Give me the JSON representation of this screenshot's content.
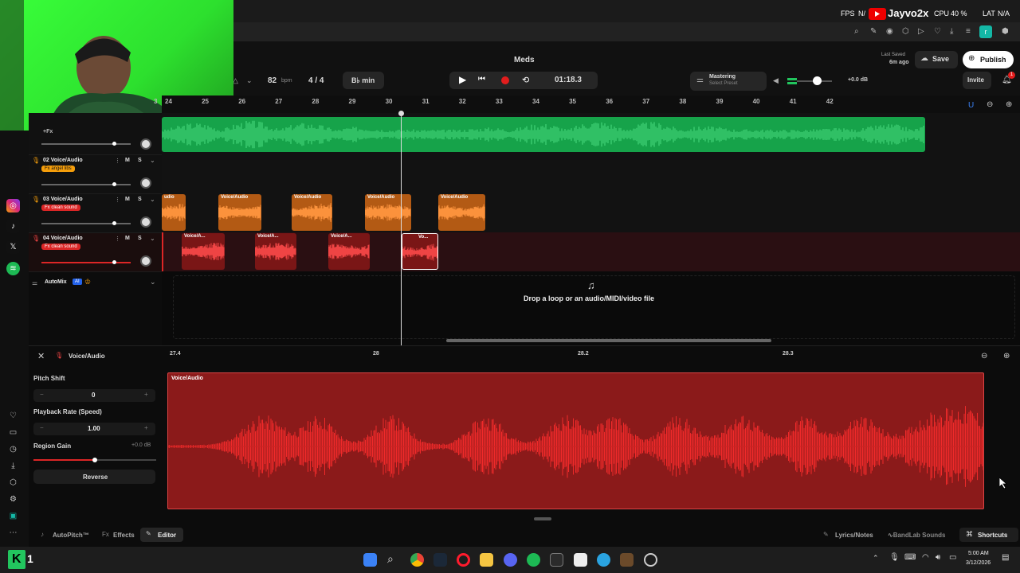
{
  "overlay": {
    "fps_label": "FPS",
    "fps_value": "N/",
    "streamer": "Jayvo2x",
    "cpu_label": "CPU",
    "cpu_value": "40 %",
    "lat_label": "LAT",
    "lat_value": "N/A"
  },
  "header": {
    "project_title": "Meds",
    "last_saved_label": "Last Saved",
    "last_saved_value": "6m ago",
    "save_label": "Save",
    "publish_label": "Publish",
    "invite_label": "Invite",
    "notif_count": "1",
    "bpm_value": "82",
    "bpm_unit": "bpm",
    "time_sig": "4 / 4",
    "key": "B♭ min",
    "time": "01:18.3",
    "mastering_label": "Mastering",
    "mastering_sub": "Select Preset",
    "volume_db": "+0.0 dB"
  },
  "ruler": {
    "ticks": [
      "3",
      "24",
      "25",
      "26",
      "27",
      "28",
      "29",
      "30",
      "31",
      "32",
      "33",
      "34",
      "35",
      "36",
      "37",
      "38",
      "39",
      "40",
      "41",
      "42"
    ]
  },
  "tracks": [
    {
      "name": "+Fx",
      "fx": ""
    },
    {
      "name": "02 Voice/Audio",
      "fx": "Fx angel libs"
    },
    {
      "name": "03 Voice/Audio",
      "fx": "Fx clean sound"
    },
    {
      "name": "04 Voice/Audio",
      "fx": "Fx clean sound"
    }
  ],
  "track_controls": {
    "mute": "M",
    "solo": "S"
  },
  "clips": {
    "orange_label": "Voice/Audio",
    "orange_first": "udio",
    "red_label": "Voice/A...",
    "red_last": "Vo..."
  },
  "automix": {
    "label": "AutoMix",
    "badge": "AI"
  },
  "drop_hint": "Drop a loop or an audio/MIDI/video file",
  "editor": {
    "title": "Voice/Audio",
    "ruler_ticks": [
      "27.4",
      "28",
      "28.2",
      "28.3"
    ],
    "clip_label": "Voice/Audio",
    "pitch_label": "Pitch Shift",
    "pitch_value": "0",
    "rate_label": "Playback Rate (Speed)",
    "rate_value": "1.00",
    "gain_label": "Region Gain",
    "gain_value": "+0.0 dB",
    "reverse_label": "Reverse",
    "minus": "−",
    "plus": "+"
  },
  "bottom_tabs": {
    "autopitch": "AutoPitch™",
    "effects": "Effects",
    "editor": "Editor",
    "lyrics": "Lyrics/Notes",
    "sounds": "BandLab Sounds",
    "shortcuts": "Shortcuts"
  },
  "taskbar": {
    "logo_num": "1",
    "time": "5:00 AM",
    "date": "3/12/2026"
  },
  "colors": {
    "accent_green": "#22c55e",
    "clip_orange": "#b35a14",
    "clip_red": "#7a1616",
    "record_red": "#e11d1d",
    "fx_orange": "#f59e0b",
    "fx_red": "#dc2626"
  }
}
